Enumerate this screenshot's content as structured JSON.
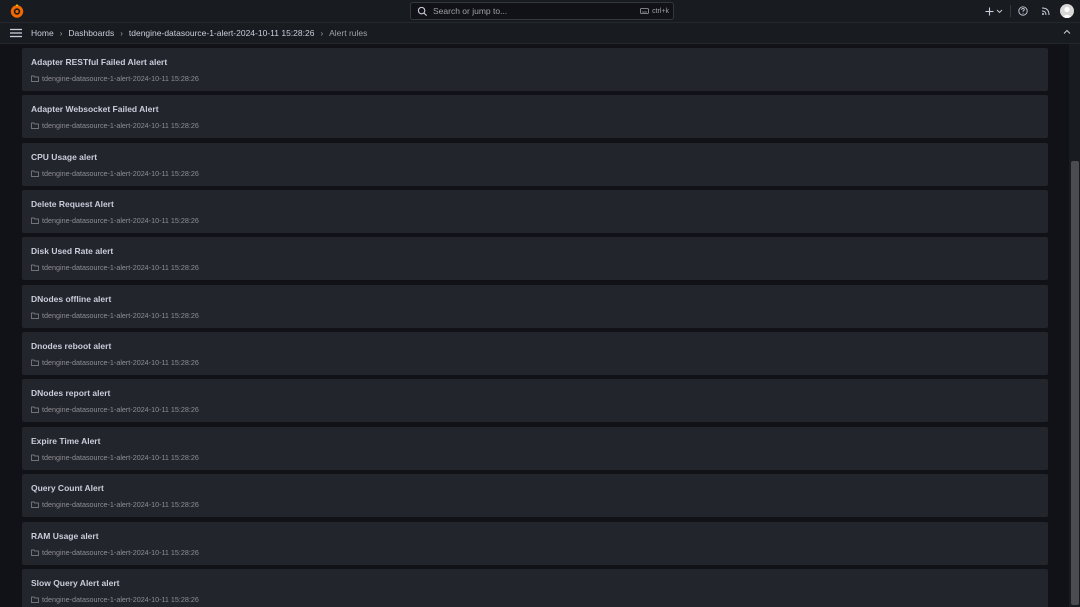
{
  "search": {
    "placeholder": "Search or jump to...",
    "shortcut": "ctrl+k"
  },
  "breadcrumb": [
    {
      "label": "Home"
    },
    {
      "label": "Dashboards"
    },
    {
      "label": "tdengine-datasource-1-alert-2024-10-11 15:28:26"
    },
    {
      "label": "Alert rules"
    }
  ],
  "alerts": [
    {
      "title": "Adapter RESTful Failed Alert alert",
      "folder": "tdengine-datasource-1-alert-2024-10-11 15:28:26"
    },
    {
      "title": "Adapter Websocket Failed Alert",
      "folder": "tdengine-datasource-1-alert-2024-10-11 15:28:26"
    },
    {
      "title": "CPU Usage alert",
      "folder": "tdengine-datasource-1-alert-2024-10-11 15:28:26"
    },
    {
      "title": "Delete Request Alert",
      "folder": "tdengine-datasource-1-alert-2024-10-11 15:28:26"
    },
    {
      "title": "Disk Used Rate alert",
      "folder": "tdengine-datasource-1-alert-2024-10-11 15:28:26"
    },
    {
      "title": "DNodes offline alert",
      "folder": "tdengine-datasource-1-alert-2024-10-11 15:28:26"
    },
    {
      "title": "Dnodes reboot alert",
      "folder": "tdengine-datasource-1-alert-2024-10-11 15:28:26"
    },
    {
      "title": "DNodes report alert",
      "folder": "tdengine-datasource-1-alert-2024-10-11 15:28:26"
    },
    {
      "title": "Expire Time Alert",
      "folder": "tdengine-datasource-1-alert-2024-10-11 15:28:26"
    },
    {
      "title": "Query Count Alert",
      "folder": "tdengine-datasource-1-alert-2024-10-11 15:28:26"
    },
    {
      "title": "RAM Usage alert",
      "folder": "tdengine-datasource-1-alert-2024-10-11 15:28:26"
    },
    {
      "title": "Slow Query Alert alert",
      "folder": "tdengine-datasource-1-alert-2024-10-11 15:28:26"
    }
  ],
  "icons": {
    "logo": "grafana-logo-icon",
    "search": "search-icon",
    "add": "plus-icon",
    "help": "help-icon",
    "news": "rss-icon",
    "menu": "menu-icon",
    "folder": "folder-icon"
  },
  "colors": {
    "background": "#111217",
    "panel": "#22252b",
    "bar": "#181b1f",
    "logo": "#f46800"
  }
}
